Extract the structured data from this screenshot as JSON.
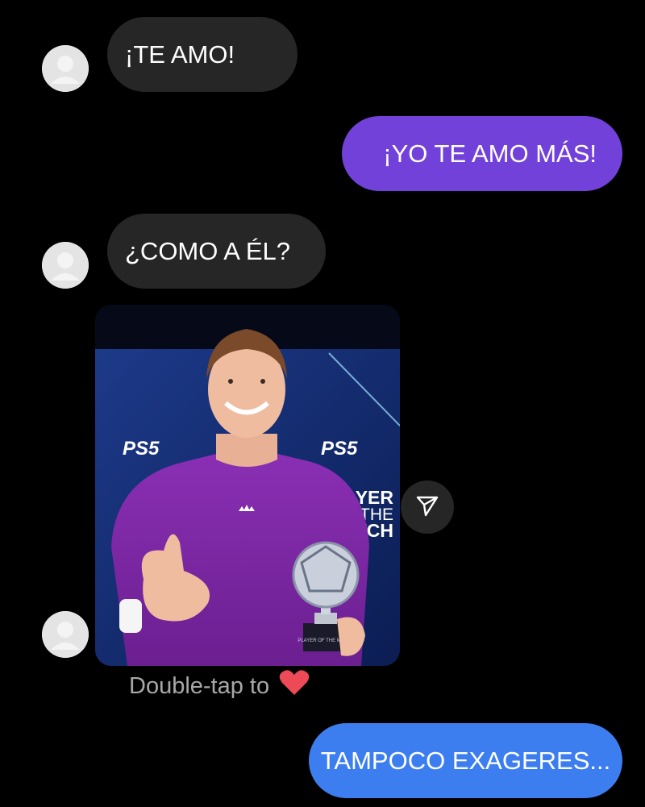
{
  "messages": [
    {
      "direction": "incoming",
      "text": "¡TE AMO!"
    },
    {
      "direction": "outgoing",
      "text": "¡YO TE AMO MÁS!"
    },
    {
      "direction": "incoming",
      "text": "¿COMO A ÉL?"
    },
    {
      "direction": "incoming",
      "type": "shared-photo"
    },
    {
      "direction": "outgoing",
      "text": "TAMPOCO EXAGERES..."
    }
  ],
  "shared_photo": {
    "backdrop_brand_left": "PS5",
    "backdrop_brand_right": "PS5",
    "backdrop_text_lines": [
      "AYER",
      "THE",
      "ATCH"
    ],
    "trophy_plate": "PLAYER OF THE MATCH"
  },
  "reaction_hint": {
    "text": "Double-tap to",
    "icon": "heart-icon"
  },
  "share_icon": "send-icon",
  "colors": {
    "background": "#000000",
    "incoming_bubble": "#262626",
    "outgoing_bubble_purple": "#7241d9",
    "outgoing_bubble_blue": "#3c7ef0",
    "heart": "#ed4956"
  }
}
